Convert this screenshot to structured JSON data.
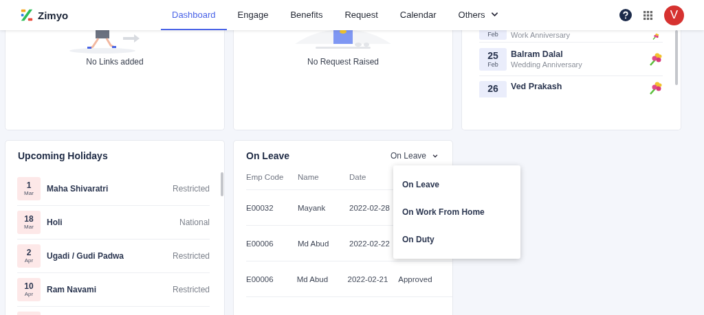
{
  "header": {
    "brand": "Zimyo",
    "nav": [
      {
        "label": "Dashboard",
        "selected": true,
        "has_menu": false
      },
      {
        "label": "Engage",
        "selected": false,
        "has_menu": false
      },
      {
        "label": "Benefits",
        "selected": false,
        "has_menu": false
      },
      {
        "label": "Request",
        "selected": false,
        "has_menu": false
      },
      {
        "label": "Calendar",
        "selected": false,
        "has_menu": false
      },
      {
        "label": "Others",
        "selected": false,
        "has_menu": true
      }
    ],
    "avatar": "V"
  },
  "links_card": {
    "empty_text": "No Links added"
  },
  "request_card": {
    "empty_text": "No Request Raised"
  },
  "celebrations": {
    "items": [
      {
        "kind": "partial",
        "month": "Feb",
        "subtitle": "Work Anniversary"
      },
      {
        "kind": "full",
        "day": "25",
        "month": "Feb",
        "name": "Balram Dalal",
        "subtitle": "Wedding Anniversary"
      },
      {
        "kind": "top",
        "day": "26",
        "name": "Ved Prakash"
      }
    ]
  },
  "holidays": {
    "title": "Upcoming Holidays",
    "items": [
      {
        "day": "1",
        "month": "Mar",
        "name": "Maha Shivaratri",
        "type": "Restricted"
      },
      {
        "day": "18",
        "month": "Mar",
        "name": "Holi",
        "type": "National"
      },
      {
        "day": "2",
        "month": "Apr",
        "name": "Ugadi / Gudi Padwa",
        "type": "Restricted"
      },
      {
        "day": "10",
        "month": "Apr",
        "name": "Ram Navami",
        "type": "Restricted"
      }
    ]
  },
  "on_leave": {
    "title": "On Leave",
    "filter": "On Leave",
    "columns": [
      "Emp Code",
      "Name",
      "Date"
    ],
    "rows": [
      {
        "code": "E00032",
        "name": "Mayank",
        "date": "2022-02-28"
      },
      {
        "code": "E00006",
        "name": "Md Abud",
        "date": "2022-02-22"
      },
      {
        "code": "E00006",
        "name": "Md Abud",
        "date": "2022-02-21",
        "status": "Approved"
      }
    ],
    "menu": [
      {
        "label": "On Leave"
      },
      {
        "label": "On Work From Home"
      },
      {
        "label": "On Duty"
      }
    ]
  }
}
